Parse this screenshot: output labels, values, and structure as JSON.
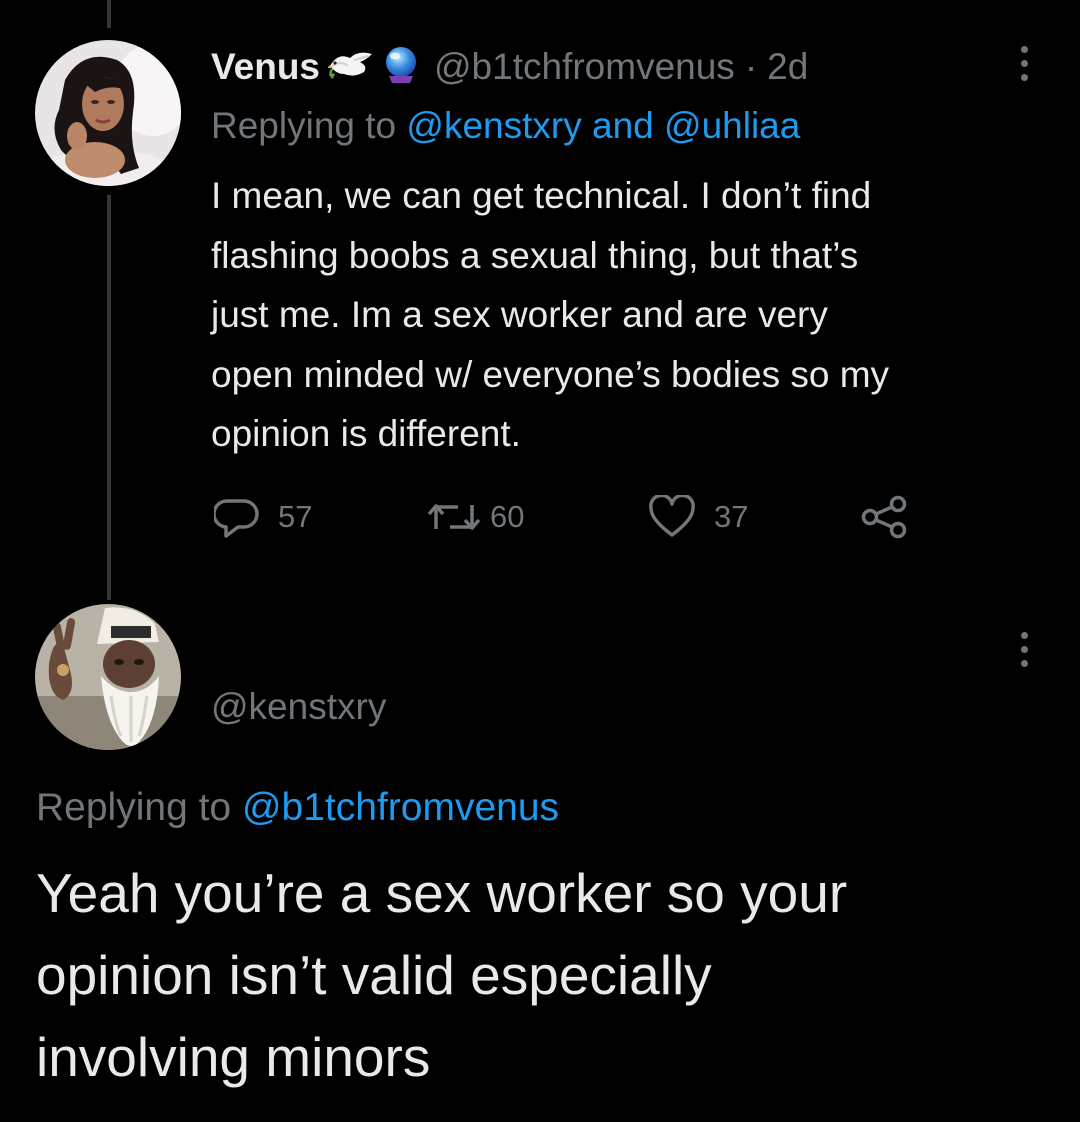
{
  "first_tweet": {
    "display_name": "Venus",
    "name_emojis": [
      "dove-emoji",
      "crystal-ball-emoji"
    ],
    "handle": "@b1tchfromvenus",
    "separator": "·",
    "time": "2d",
    "replying_prefix": "Replying to",
    "replying_mention_1": "@kenstxry",
    "replying_and": "and",
    "replying_mention_2": "@uhliaa",
    "text_lines": [
      "I mean, we can get technical. I don’t find",
      "flashing boobs a sexual thing, but that’s",
      "just me. Im a sex worker and are very",
      "open minded w/ everyone’s bodies so my",
      "opinion is different."
    ],
    "actions": {
      "replies": "57",
      "retweets": "60",
      "likes": "37"
    }
  },
  "second_tweet": {
    "display_name": "",
    "handle": "@kenstxry",
    "replying_prefix": "Replying to",
    "replying_mention": "@b1tchfromvenus",
    "text_lines": [
      "Yeah you’re a sex worker so your",
      "opinion isn’t valid especially",
      "involving minors"
    ]
  },
  "colors": {
    "background": "#000000",
    "text_primary": "#e7e9ea",
    "text_secondary": "#71767b",
    "accent": "#1d9bf0",
    "thread_line": "#333639"
  }
}
